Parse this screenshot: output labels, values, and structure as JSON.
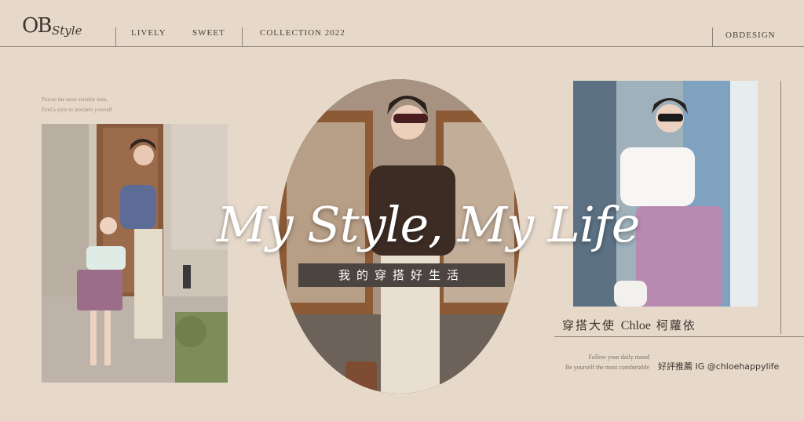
{
  "header": {
    "logo_ob": "OB",
    "logo_style": "Style",
    "nav": [
      "LIVELY",
      "SWEET",
      "COLLECTION 2022"
    ],
    "brand": "OBDESIGN"
  },
  "tagline": {
    "line1": "Pursue the most suitable item,",
    "line2": "Find a style to interpret yourself"
  },
  "hero": {
    "title": "My Style, My Life",
    "subtitle": "我的穿搭好生活"
  },
  "ambassador": {
    "prefix": "穿搭大使",
    "name_en": "Chloe",
    "name_zh": "柯蘿依"
  },
  "footer": {
    "line1": "Follow your daily mood",
    "line2": "Be yourself the most comfortable",
    "recommend": "好評推薦 IG @chloehappylife"
  },
  "colors": {
    "background": "#e6d9ca",
    "line": "#8d8078",
    "subtitle_bg": "#4b4440"
  }
}
